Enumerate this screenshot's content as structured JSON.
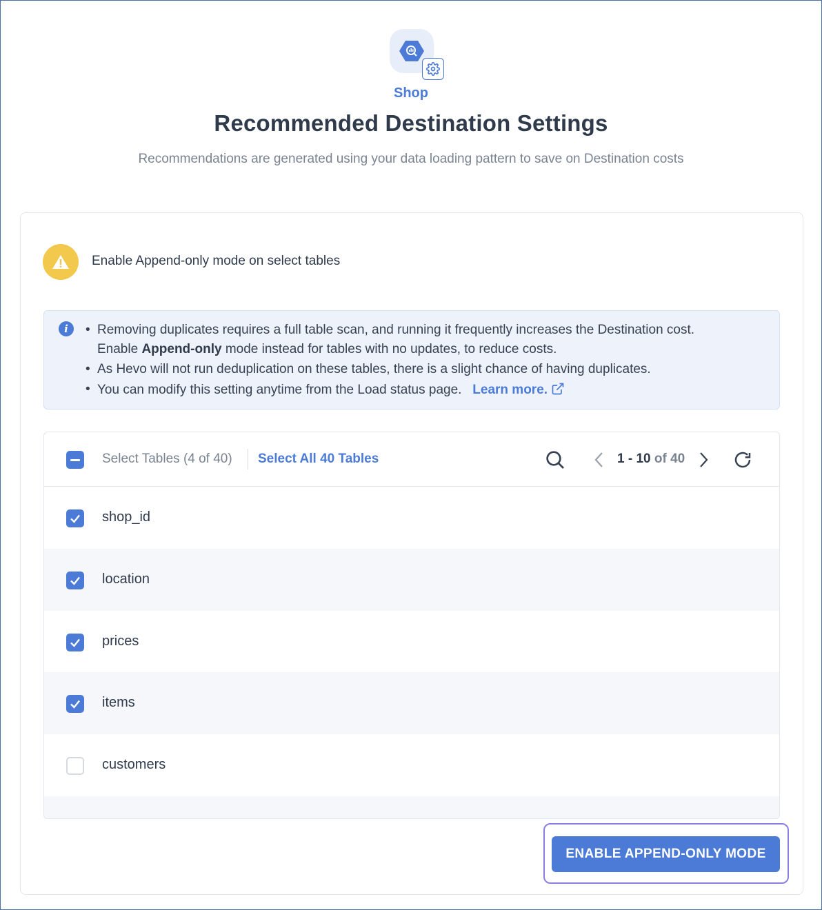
{
  "header": {
    "destination_name": "Shop",
    "title": "Recommended Destination Settings",
    "subtitle": "Recommendations are generated using your data loading pattern to save on Destination costs"
  },
  "recommendation": {
    "title": "Enable Append-only mode on select tables",
    "info": {
      "line1": "Removing duplicates requires a full table scan, and running it frequently increases the Destination cost.",
      "line2_prefix": "Enable ",
      "line2_bold": "Append-only",
      "line2_suffix": " mode instead for tables with no updates, to reduce costs.",
      "line3": "As Hevo will not run deduplication on these tables, there is a slight chance of having duplicates.",
      "line4": "You can modify this setting anytime from the Load status page.",
      "learn_more": "Learn more."
    }
  },
  "table": {
    "select_label": "Select Tables (4 of 40)",
    "select_all_label": "Select All 40 Tables",
    "pagination": {
      "range": "1 - 10",
      "of": "of 40"
    },
    "rows": [
      {
        "name": "shop_id",
        "checked": true
      },
      {
        "name": "location",
        "checked": true
      },
      {
        "name": "prices",
        "checked": true
      },
      {
        "name": "items",
        "checked": true
      },
      {
        "name": "customers",
        "checked": false
      }
    ]
  },
  "actions": {
    "primary_label": "ENABLE APPEND-ONLY MODE"
  },
  "icons": {
    "logo": "bigquery-hex-icon",
    "badge": "gear-icon",
    "warning": "warning-icon",
    "info": "info-icon",
    "external": "external-link-icon",
    "search": "search-icon",
    "prev": "chevron-left-icon",
    "next": "chevron-right-icon",
    "refresh": "refresh-icon"
  },
  "colors": {
    "accent": "#4b7bd6",
    "warning": "#f2c94c",
    "info_bg": "#edf2fb",
    "title": "#2f3a4b",
    "focus_ring": "#8a7ee0"
  }
}
